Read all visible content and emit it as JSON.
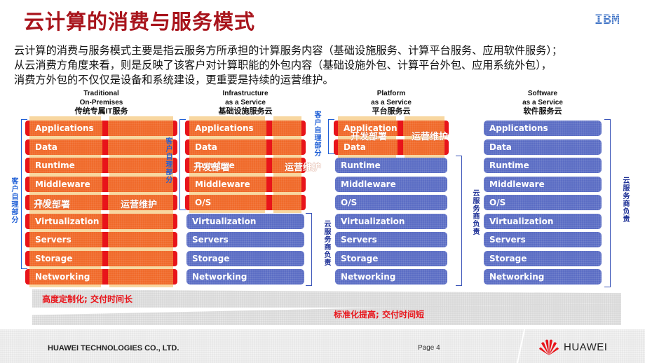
{
  "header": {
    "title": "云计算的消费与服务模式",
    "logo_text": "IBM"
  },
  "description": [
    "云计算的消费与服务模式主要是指云服务方所承担的计算服务内容（基础设施服务、计算平台服务、应用软件服务）；",
    "从云消费方角度来看，则是反映了该客户对计算职能的外包内容（基础设施外包、计算平台外包、应用系统外包），",
    "消费方外包的不仅仅是设备和系统建设，更重要是持续的运营维护。"
  ],
  "layers": [
    "Applications",
    "Data",
    "Runtime",
    "Middleware",
    "O/S",
    "Virtualization",
    "Servers",
    "Storage",
    "Networking"
  ],
  "models": [
    {
      "id": "traditional",
      "heading_en_1": "Traditional",
      "heading_en_2": "On-Premises",
      "heading_cn": "传统专属IT服务",
      "customer_managed_layers": 9,
      "dev_label": "开发部署",
      "ops_label": "运营维护",
      "customer_label": "客户自理部分",
      "provider_label": ""
    },
    {
      "id": "iaas",
      "heading_en_1": "Infrastructure",
      "heading_en_2": "as a Service",
      "heading_cn": "基础设施服务云",
      "customer_managed_layers": 5,
      "dev_label": "开发部署",
      "ops_label": "运营维护",
      "customer_label": "客户自理部分",
      "provider_label": "云服务商负责"
    },
    {
      "id": "paas",
      "heading_en_1": "Platform",
      "heading_en_2": "as a Service",
      "heading_cn": "平台服务云",
      "customer_managed_layers": 2,
      "dev_label": "开发部署",
      "ops_label": "运营维护",
      "customer_label": "客户自理部分",
      "provider_label": "云服务商负责"
    },
    {
      "id": "saas",
      "heading_en_1": "Software",
      "heading_en_2": "as a Service",
      "heading_cn": "软件服务云",
      "customer_managed_layers": 0,
      "dev_label": "",
      "ops_label": "",
      "customer_label": "",
      "provider_label": "云服务商负责"
    }
  ],
  "bands": {
    "left_text": "高度定制化; 交付时间长",
    "right_text": "标准化提高; 交付时间短"
  },
  "footer": {
    "company": "HUAWEI TECHNOLOGIES CO., LTD.",
    "page": "Page 4",
    "brand": "HUAWEI"
  },
  "colors": {
    "title": "#a8141c",
    "customer_block": "#f06a2a",
    "provider_block": "#5b6dc4",
    "accent_red": "#e8141a",
    "customer_label": "#1f5fd6",
    "provider_label": "#1c2f95"
  }
}
